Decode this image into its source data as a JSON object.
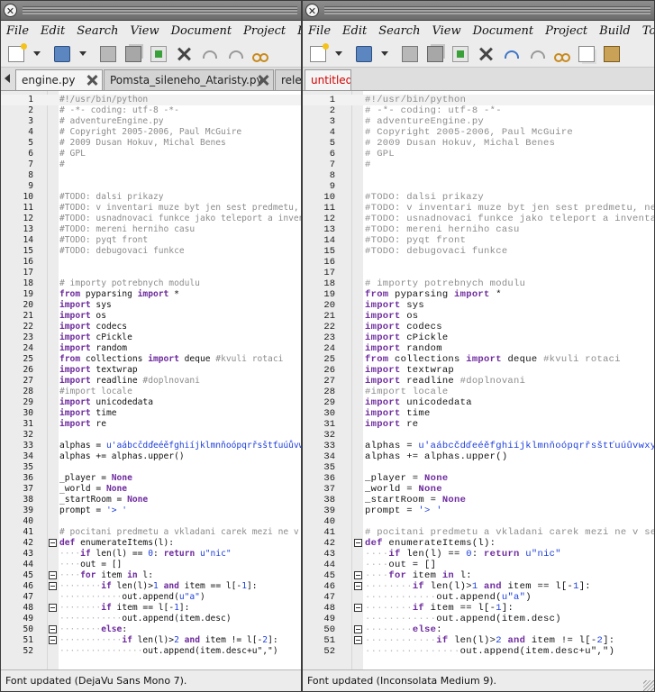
{
  "menu": [
    "File",
    "Edit",
    "Search",
    "View",
    "Document",
    "Project",
    "Build",
    "Tools"
  ],
  "left": {
    "tabs": [
      {
        "label": "engine.py",
        "active": true
      },
      {
        "label": "Pomsta_sileneho_Ataristy.py",
        "active": false
      },
      {
        "label": "release",
        "active": false
      }
    ],
    "status": "Font updated (DejaVu Sans Mono 7)."
  },
  "right": {
    "tabs": [
      {
        "label": "untitled",
        "active": true,
        "color": "#d40000"
      }
    ],
    "status": "Font updated (Inconsolata Medium 9)."
  },
  "lines": [
    {
      "n": "1",
      "t": [
        [
          "cmt",
          "#!/usr/bin/python"
        ]
      ]
    },
    {
      "n": "2",
      "t": [
        [
          "cmt",
          "# -*- coding: utf-8 -*-"
        ]
      ]
    },
    {
      "n": "3",
      "t": [
        [
          "cmt",
          "# adventureEngine.py"
        ]
      ]
    },
    {
      "n": "4",
      "t": [
        [
          "cmt",
          "# Copyright 2005-2006, Paul McGuire"
        ]
      ]
    },
    {
      "n": "5",
      "t": [
        [
          "cmt",
          "# 2009 Dusan Hokuv, Michal Benes"
        ]
      ]
    },
    {
      "n": "6",
      "t": [
        [
          "cmt",
          "# GPL"
        ]
      ]
    },
    {
      "n": "7",
      "t": [
        [
          "cmt",
          "#"
        ]
      ]
    },
    {
      "n": "8",
      "t": []
    },
    {
      "n": "9",
      "t": []
    },
    {
      "n": "10",
      "t": [
        [
          "cmt",
          "#TODO: dalsi prikazy"
        ]
      ]
    },
    {
      "n": "11",
      "t": [
        [
          "cmt",
          "#TODO: v inventari muze byt jen sest predmetu, nebo dalsi omezeni"
        ]
      ]
    },
    {
      "n": "12",
      "t": [
        [
          "cmt",
          "#TODO: usnadnovaci funkce jako teleport a inventar co jen chci"
        ]
      ]
    },
    {
      "n": "13",
      "t": [
        [
          "cmt",
          "#TODO: mereni herniho casu"
        ]
      ]
    },
    {
      "n": "14",
      "t": [
        [
          "cmt",
          "#TODO: pyqt front"
        ]
      ]
    },
    {
      "n": "15",
      "t": [
        [
          "cmt",
          "#TODO: debugovaci funkce"
        ]
      ]
    },
    {
      "n": "16",
      "t": []
    },
    {
      "n": "17",
      "t": []
    },
    {
      "n": "18",
      "t": [
        [
          "cmt",
          "# importy potrebnych modulu"
        ]
      ]
    },
    {
      "n": "19",
      "t": [
        [
          "kw",
          "from"
        ],
        [
          "",
          " pyparsing "
        ],
        [
          "kw",
          "import"
        ],
        [
          "",
          " *"
        ]
      ]
    },
    {
      "n": "20",
      "t": [
        [
          "kw",
          "import"
        ],
        [
          "",
          " sys"
        ]
      ]
    },
    {
      "n": "21",
      "t": [
        [
          "kw",
          "import"
        ],
        [
          "",
          " os"
        ]
      ]
    },
    {
      "n": "22",
      "t": [
        [
          "kw",
          "import"
        ],
        [
          "",
          " codecs"
        ]
      ]
    },
    {
      "n": "23",
      "t": [
        [
          "kw",
          "import"
        ],
        [
          "",
          " cPickle"
        ]
      ]
    },
    {
      "n": "24",
      "t": [
        [
          "kw",
          "import"
        ],
        [
          "",
          " random"
        ]
      ]
    },
    {
      "n": "25",
      "t": [
        [
          "kw",
          "from"
        ],
        [
          "",
          " collections "
        ],
        [
          "kw",
          "import"
        ],
        [
          "",
          " deque "
        ],
        [
          "cmt",
          "#kvuli rotaci"
        ]
      ]
    },
    {
      "n": "26",
      "t": [
        [
          "kw",
          "import"
        ],
        [
          "",
          " textwrap"
        ]
      ]
    },
    {
      "n": "27",
      "t": [
        [
          "kw",
          "import"
        ],
        [
          "",
          " readline "
        ],
        [
          "cmt",
          "#doplnovani"
        ]
      ]
    },
    {
      "n": "28",
      "t": [
        [
          "cmt",
          "#import locale"
        ]
      ]
    },
    {
      "n": "29",
      "t": [
        [
          "kw",
          "import"
        ],
        [
          "",
          " unicodedata"
        ]
      ]
    },
    {
      "n": "30",
      "t": [
        [
          "kw",
          "import"
        ],
        [
          "",
          " time"
        ]
      ]
    },
    {
      "n": "31",
      "t": [
        [
          "kw",
          "import"
        ],
        [
          "",
          " re"
        ]
      ]
    },
    {
      "n": "32",
      "t": []
    },
    {
      "n": "33",
      "t": [
        [
          "",
          "alphas = "
        ],
        [
          "str",
          "u'aábcčdďeéěfghiíjklmnňoópqrřsštťuúůvwxyýzž'"
        ]
      ]
    },
    {
      "n": "34",
      "t": [
        [
          "",
          "alphas += alphas.upper()"
        ]
      ]
    },
    {
      "n": "35",
      "t": []
    },
    {
      "n": "36",
      "t": [
        [
          "",
          "_player = "
        ],
        [
          "kw",
          "None"
        ]
      ]
    },
    {
      "n": "37",
      "t": [
        [
          "",
          "_world = "
        ],
        [
          "kw",
          "None"
        ]
      ]
    },
    {
      "n": "38",
      "t": [
        [
          "",
          "_startRoom = "
        ],
        [
          "kw",
          "None"
        ]
      ]
    },
    {
      "n": "39",
      "t": [
        [
          "",
          "prompt = "
        ],
        [
          "str",
          "'> '"
        ]
      ]
    },
    {
      "n": "40",
      "t": []
    },
    {
      "n": "41",
      "t": [
        [
          "cmt",
          "# pocitani predmetu a vkladani carek mezi ne v seznamu"
        ]
      ]
    },
    {
      "n": "42",
      "f": true,
      "t": [
        [
          "kw",
          "def"
        ],
        [
          "",
          " enumerateItems(l):"
        ]
      ]
    },
    {
      "n": "43",
      "t": [
        [
          "dot",
          "····"
        ],
        [
          "kw",
          "if"
        ],
        [
          "",
          " len(l) == "
        ],
        [
          "num",
          "0"
        ],
        [
          "",
          ": "
        ],
        [
          "kw",
          "return"
        ],
        [
          "",
          " "
        ],
        [
          "str",
          "u\"nic\""
        ]
      ]
    },
    {
      "n": "44",
      "t": [
        [
          "dot",
          "····"
        ],
        [
          "",
          "out = []"
        ]
      ]
    },
    {
      "n": "45",
      "f": true,
      "t": [
        [
          "dot",
          "····"
        ],
        [
          "kw",
          "for"
        ],
        [
          "",
          " item "
        ],
        [
          "kw",
          "in"
        ],
        [
          "",
          " l:"
        ]
      ]
    },
    {
      "n": "46",
      "f": true,
      "t": [
        [
          "dot",
          "········"
        ],
        [
          "kw",
          "if"
        ],
        [
          "",
          " len(l)>"
        ],
        [
          "num",
          "1"
        ],
        [
          "",
          " "
        ],
        [
          "kw",
          "and"
        ],
        [
          "",
          " item == l[-"
        ],
        [
          "num",
          "1"
        ],
        [
          "",
          "]:"
        ]
      ]
    },
    {
      "n": "47",
      "t": [
        [
          "dot",
          "············"
        ],
        [
          "",
          "out.append("
        ],
        [
          "str",
          "u\"a\""
        ],
        [
          "",
          ")"
        ]
      ]
    },
    {
      "n": "48",
      "f": true,
      "t": [
        [
          "dot",
          "········"
        ],
        [
          "kw",
          "if"
        ],
        [
          "",
          " item == l[-"
        ],
        [
          "num",
          "1"
        ],
        [
          "",
          "]:"
        ]
      ]
    },
    {
      "n": "49",
      "t": [
        [
          "dot",
          "············"
        ],
        [
          "",
          "out.append(item.desc)"
        ]
      ]
    },
    {
      "n": "50",
      "f": true,
      "t": [
        [
          "dot",
          "········"
        ],
        [
          "kw",
          "else"
        ],
        [
          "",
          ":"
        ]
      ]
    },
    {
      "n": "51",
      "f": true,
      "t": [
        [
          "dot",
          "············"
        ],
        [
          "kw",
          "if"
        ],
        [
          "",
          " len(l)>"
        ],
        [
          "num",
          "2"
        ],
        [
          "",
          " "
        ],
        [
          "kw",
          "and"
        ],
        [
          "",
          " item != l[-"
        ],
        [
          "num",
          "2"
        ],
        [
          "",
          "]:"
        ]
      ]
    },
    {
      "n": "52",
      "t": [
        [
          "dot",
          "················"
        ],
        [
          "",
          "out.append(item.desc+u\",\")"
        ]
      ]
    }
  ]
}
